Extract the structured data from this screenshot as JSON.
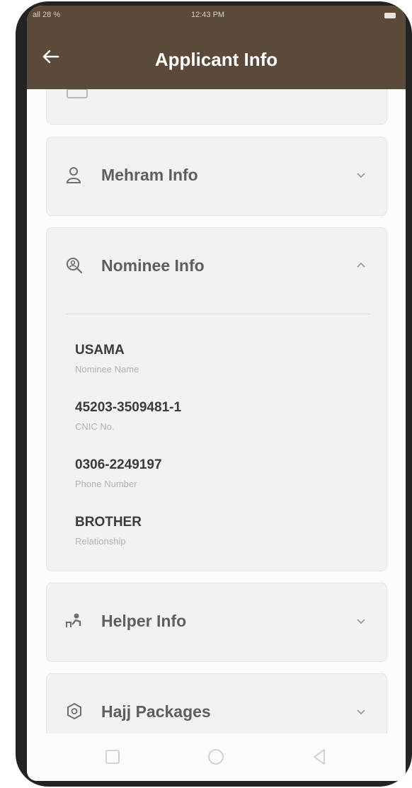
{
  "status_bar": {
    "left": "all 28 %",
    "time": "12:43 PM"
  },
  "app_bar": {
    "title": "Applicant Info"
  },
  "sections": {
    "mehram": {
      "label": "Mehram Info"
    },
    "nominee": {
      "label": "Nominee Info",
      "fields": [
        {
          "value": "USAMA",
          "label": "Nominee Name"
        },
        {
          "value": "45203-3509481-1",
          "label": "CNIC No."
        },
        {
          "value": "0306-2249197",
          "label": "Phone Number"
        },
        {
          "value": "BROTHER",
          "label": "Relationship"
        }
      ]
    },
    "helper": {
      "label": "Helper Info"
    },
    "hajj": {
      "label": "Hajj Packages"
    }
  },
  "colors": {
    "accent": "#5b4a3a",
    "card": "#f2f2f2",
    "text": "#5e5e5e"
  },
  "icons": [
    "back-arrow-icon",
    "person-icon",
    "search-user-icon",
    "helper-icon",
    "hajj-package-icon",
    "chevron-down-icon",
    "chevron-up-icon",
    "nav-square-icon",
    "nav-circle-icon",
    "nav-triangle-icon"
  ]
}
